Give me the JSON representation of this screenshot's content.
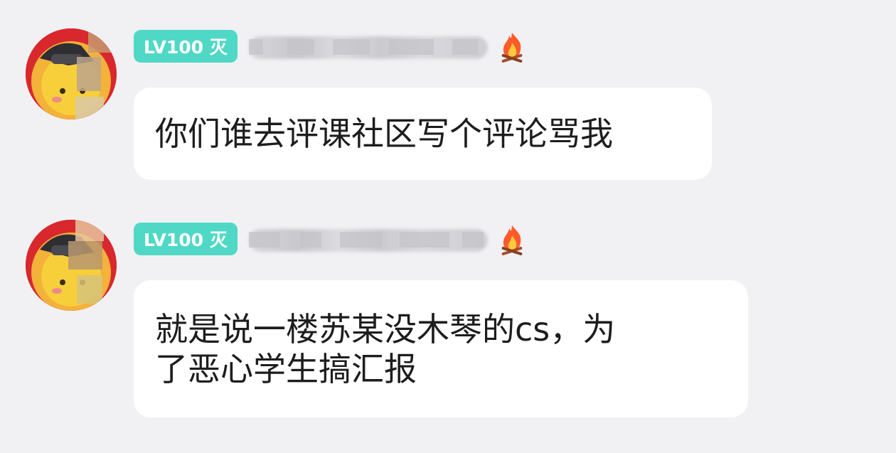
{
  "messages": [
    {
      "level_badge": "LV100 灭",
      "text": "你们谁去评课社区写个评论骂我"
    },
    {
      "level_badge": "LV100 灭",
      "text": "就是说一楼苏某没木琴的cs，为\n了恶心学生搞汇报"
    }
  ],
  "icons": {
    "fire": "fire-icon"
  },
  "colors": {
    "background": "#f1f1f4",
    "badge": "#50d8c6",
    "bubble": "#ffffff",
    "text": "#1d1d1f"
  }
}
